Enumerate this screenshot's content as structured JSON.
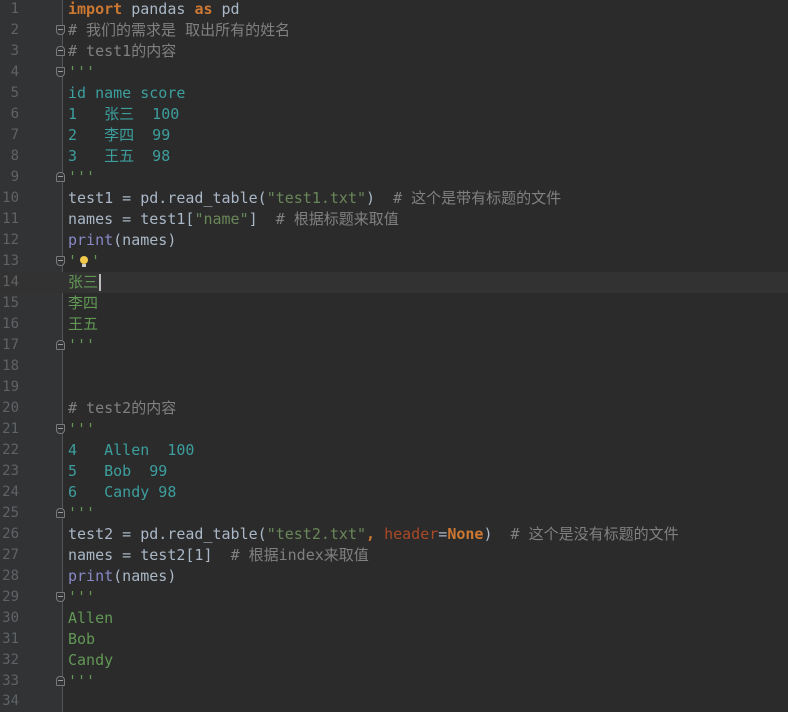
{
  "line_numbers": [
    "1",
    "2",
    "3",
    "4",
    "5",
    "6",
    "7",
    "8",
    "9",
    "10",
    "11",
    "12",
    "13",
    "14",
    "15",
    "16",
    "17",
    "18",
    "19",
    "20",
    "21",
    "22",
    "23",
    "24",
    "25",
    "26",
    "27",
    "28",
    "29",
    "30",
    "31",
    "32",
    "33",
    "34"
  ],
  "code": {
    "l1": {
      "kw_import": "import",
      "mod": " pandas ",
      "kw_as": "as",
      "alias": " pd"
    },
    "l2": {
      "comment": "# 我们的需求是 取出所有的姓名"
    },
    "l3": {
      "comment": "# test1的内容"
    },
    "l4": {
      "doc": "'''"
    },
    "l5": {
      "doc": "id name score"
    },
    "l6": {
      "doc": "1   张三  100"
    },
    "l7": {
      "doc": "2   李四  99"
    },
    "l8": {
      "doc": "3   王五  98"
    },
    "l9": {
      "doc": "'''"
    },
    "l10": {
      "a": "test1 = pd.read_table(",
      "str": "\"test1.txt\"",
      "b": ")  ",
      "comment": "# 这个是带有标题的文件"
    },
    "l11": {
      "a": "names = test1[",
      "str": "\"name\"",
      "b": "]  ",
      "comment": "# 根据标题来取值"
    },
    "l12": {
      "builtin": "print",
      "a": "(names)"
    },
    "l13": {
      "doc_a": "'",
      "doc_b": "'"
    },
    "l14": {
      "doc": "张三"
    },
    "l15": {
      "doc": "李四"
    },
    "l16": {
      "doc": "王五"
    },
    "l17": {
      "doc": "'''"
    },
    "l20": {
      "comment": "# test2的内容"
    },
    "l21": {
      "doc": "'''"
    },
    "l22": {
      "doc": "4   Allen  100"
    },
    "l23": {
      "doc": "5   Bob  99"
    },
    "l24": {
      "doc": "6   Candy 98"
    },
    "l25": {
      "doc": "'''"
    },
    "l26": {
      "a": "test2 = pd.read_table(",
      "str": "\"test2.txt\"",
      "comma": ", ",
      "param": "header",
      "eq": "=",
      "kwv": "None",
      "b": ")  ",
      "comment": "# 这个是没有标题的文件"
    },
    "l27": {
      "a": "names = test2[1]  ",
      "comment": "# 根据index来取值"
    },
    "l28": {
      "builtin": "print",
      "a": "(names)"
    },
    "l29": {
      "doc": "'''"
    },
    "l30": {
      "doc": "Allen"
    },
    "l31": {
      "doc": "Bob"
    },
    "l32": {
      "doc": "Candy"
    },
    "l33": {
      "doc": "'''"
    }
  }
}
